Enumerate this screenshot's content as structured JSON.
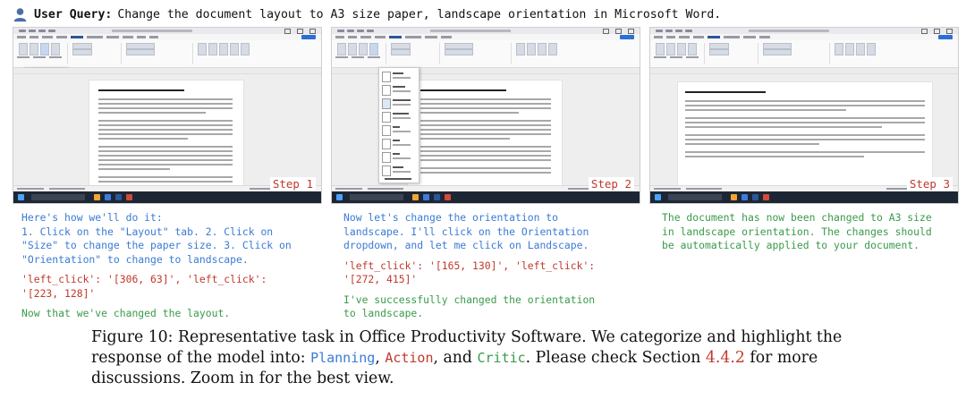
{
  "query": {
    "label": "User Query:",
    "text": "Change the document layout to A3 size paper, landscape orientation in Microsoft Word."
  },
  "screenshots": [
    {
      "step_label": "Step 1"
    },
    {
      "step_label": "Step 2"
    },
    {
      "step_label": "Step 3"
    }
  ],
  "responses": [
    {
      "planning": "Here's how we'll do it:\n1. Click on the \"Layout\" tab. 2. Click on \"Size\" to change the paper size. 3. Click on \"Orientation\" to change to landscape.",
      "action": "'left_click': '[306, 63]', 'left_click': '[223, 128]'",
      "critic": "Now that we've changed the layout."
    },
    {
      "planning": "Now let's change the orientation to landscape. I'll click on the Orientation dropdown, and let me click on Landscape.",
      "action": "'left_click': '[165, 130]', 'left_click': '[272, 415]'",
      "critic": "I've successfully changed the orientation to landscape."
    },
    {
      "critic": "The document has now been changed to A3 size in landscape orientation. The changes should be automatically applied to your document."
    }
  ],
  "caption": {
    "prefix": "Figure 10: Representative task in Office Productivity Software. We categorize and highlight the response of the model into: ",
    "planning": "Planning",
    "sep1": ", ",
    "action": "Action",
    "sep2": ", and ",
    "critic": "Critic",
    "middle": ". Please check Section ",
    "section_ref": "4.4.2",
    "suffix": " for more discussions. Zoom in for the best view."
  },
  "colors": {
    "planning": "#3a7bd5",
    "action": "#c0392b",
    "critic": "#3a9a4a"
  },
  "icons": [
    "user-icon",
    "windows-start-icon",
    "word-app-icon"
  ]
}
